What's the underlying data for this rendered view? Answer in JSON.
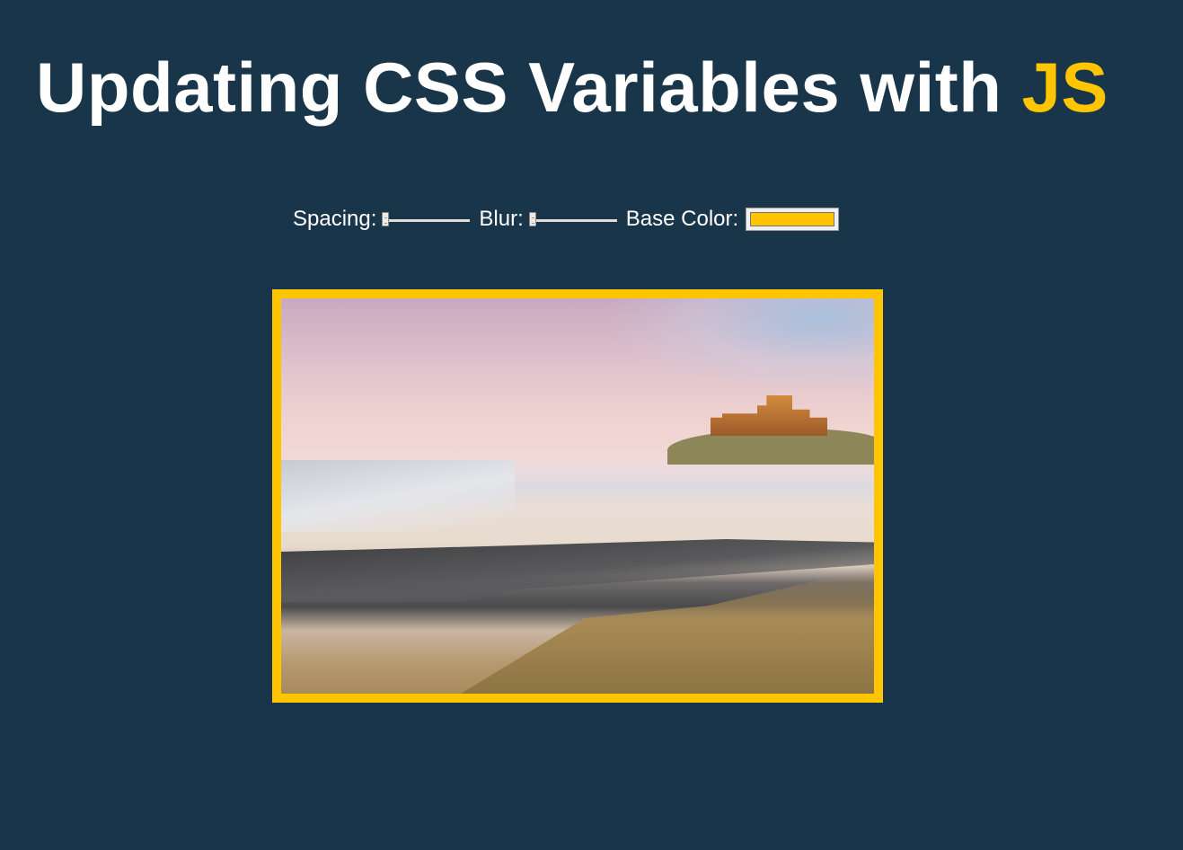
{
  "title": {
    "prefix": "Updating CSS Variables with ",
    "highlight": "JS"
  },
  "controls": {
    "spacing": {
      "label": "Spacing:",
      "value": 10,
      "min": 10,
      "max": 200
    },
    "blur": {
      "label": "Blur:",
      "value": 0,
      "min": 0,
      "max": 25
    },
    "base_color": {
      "label": "Base Color:",
      "value": "#ffc600"
    }
  },
  "colors": {
    "background": "#193549",
    "accent": "#ffc600"
  }
}
